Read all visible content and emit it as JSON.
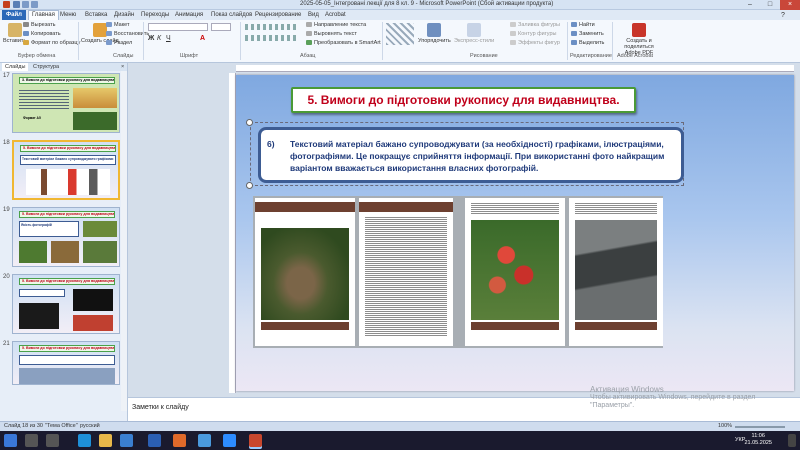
{
  "app": {
    "window_title": "2025-05-05_Інтегровані лекції для 8 кл. 9 - Microsoft PowerPoint (Сбой активации продукта)"
  },
  "menu": {
    "file": "Файл",
    "tabs": [
      "Главная",
      "Меню",
      "Вставка",
      "Дизайн",
      "Переходы",
      "Анимация",
      "Показ слайдов",
      "Рецензирование",
      "Вид",
      "Acrobat"
    ],
    "active_tab": "Главная"
  },
  "ribbon": {
    "clipboard": {
      "paste": "Вставить",
      "cut": "Вырезать",
      "copy": "Копировать",
      "format_painter": "Формат по образцу",
      "group": "Буфер обмена"
    },
    "slides": {
      "create": "Создать слайд",
      "layout": "Макет",
      "reset": "Восстановить",
      "section": "Раздел",
      "group": "Слайды"
    },
    "font_group": "Шрифт",
    "paragraph": {
      "text_direction": "Направление текста",
      "align_text": "Выровнять текст",
      "smartart": "Преобразовать в SmartArt",
      "group": "Абзац"
    },
    "drawing": {
      "arrange": "Упорядочить",
      "quick_styles": "Экспресс-стили",
      "fill": "Заливка фигуры",
      "outline": "Контур фигуры",
      "effects": "Эффекты фигур",
      "group": "Рисование"
    },
    "editing": {
      "find": "Найти",
      "replace": "Заменить",
      "select": "Выделить",
      "group": "Редактирование"
    },
    "adobe": {
      "create": "Создать и поделиться Adobe PDF",
      "group": "Adobe Acrobat"
    }
  },
  "left_pane": {
    "tabs": [
      "Слайды",
      "Структура"
    ],
    "slides": [
      {
        "num": "17",
        "title": "3. Вимоги до підготовки рукопису для видавництва.",
        "text": "Формат А5"
      },
      {
        "num": "18",
        "title": "5. Вимоги до підготовки рукопису для видавництва.",
        "text": "Текстовий матеріал бажано супроводжувати графіками"
      },
      {
        "num": "19",
        "title": "5. Вимоги до підготовки рукопису для видавництва.",
        "text": "Якість фотографій"
      },
      {
        "num": "20",
        "title": "5. Вимоги до підготовки рукопису для видавництва.",
        "text": ""
      },
      {
        "num": "21",
        "title": "5. Вимоги до підготовки рукопису для видавництва.",
        "text": ""
      }
    ]
  },
  "slide": {
    "title": "5. Вимоги до підготовки рукопису для видавництва.",
    "item_num": "6)",
    "body": "Текстовий матеріал бажано супроводжувати (за необхідності) графіками, ілюстраціями, фотографіями. Це покращує сприйняття інформації. При використанні фото найкращим варіантом вважається використання власних фотографій."
  },
  "notes": {
    "label": "Заметки к слайду"
  },
  "activation": {
    "line1": "Активация Windows",
    "line2": "Чтобы активировать Windows, перейдите в раздел \"Параметры\"."
  },
  "status": {
    "slide": "Слайд 18 из 30",
    "theme": "\"Тема Office\"",
    "lang": "русский",
    "zoom": "100%"
  },
  "taskbar": {
    "lang": "УКР",
    "time": "11:06",
    "date": "21.05.2025"
  }
}
